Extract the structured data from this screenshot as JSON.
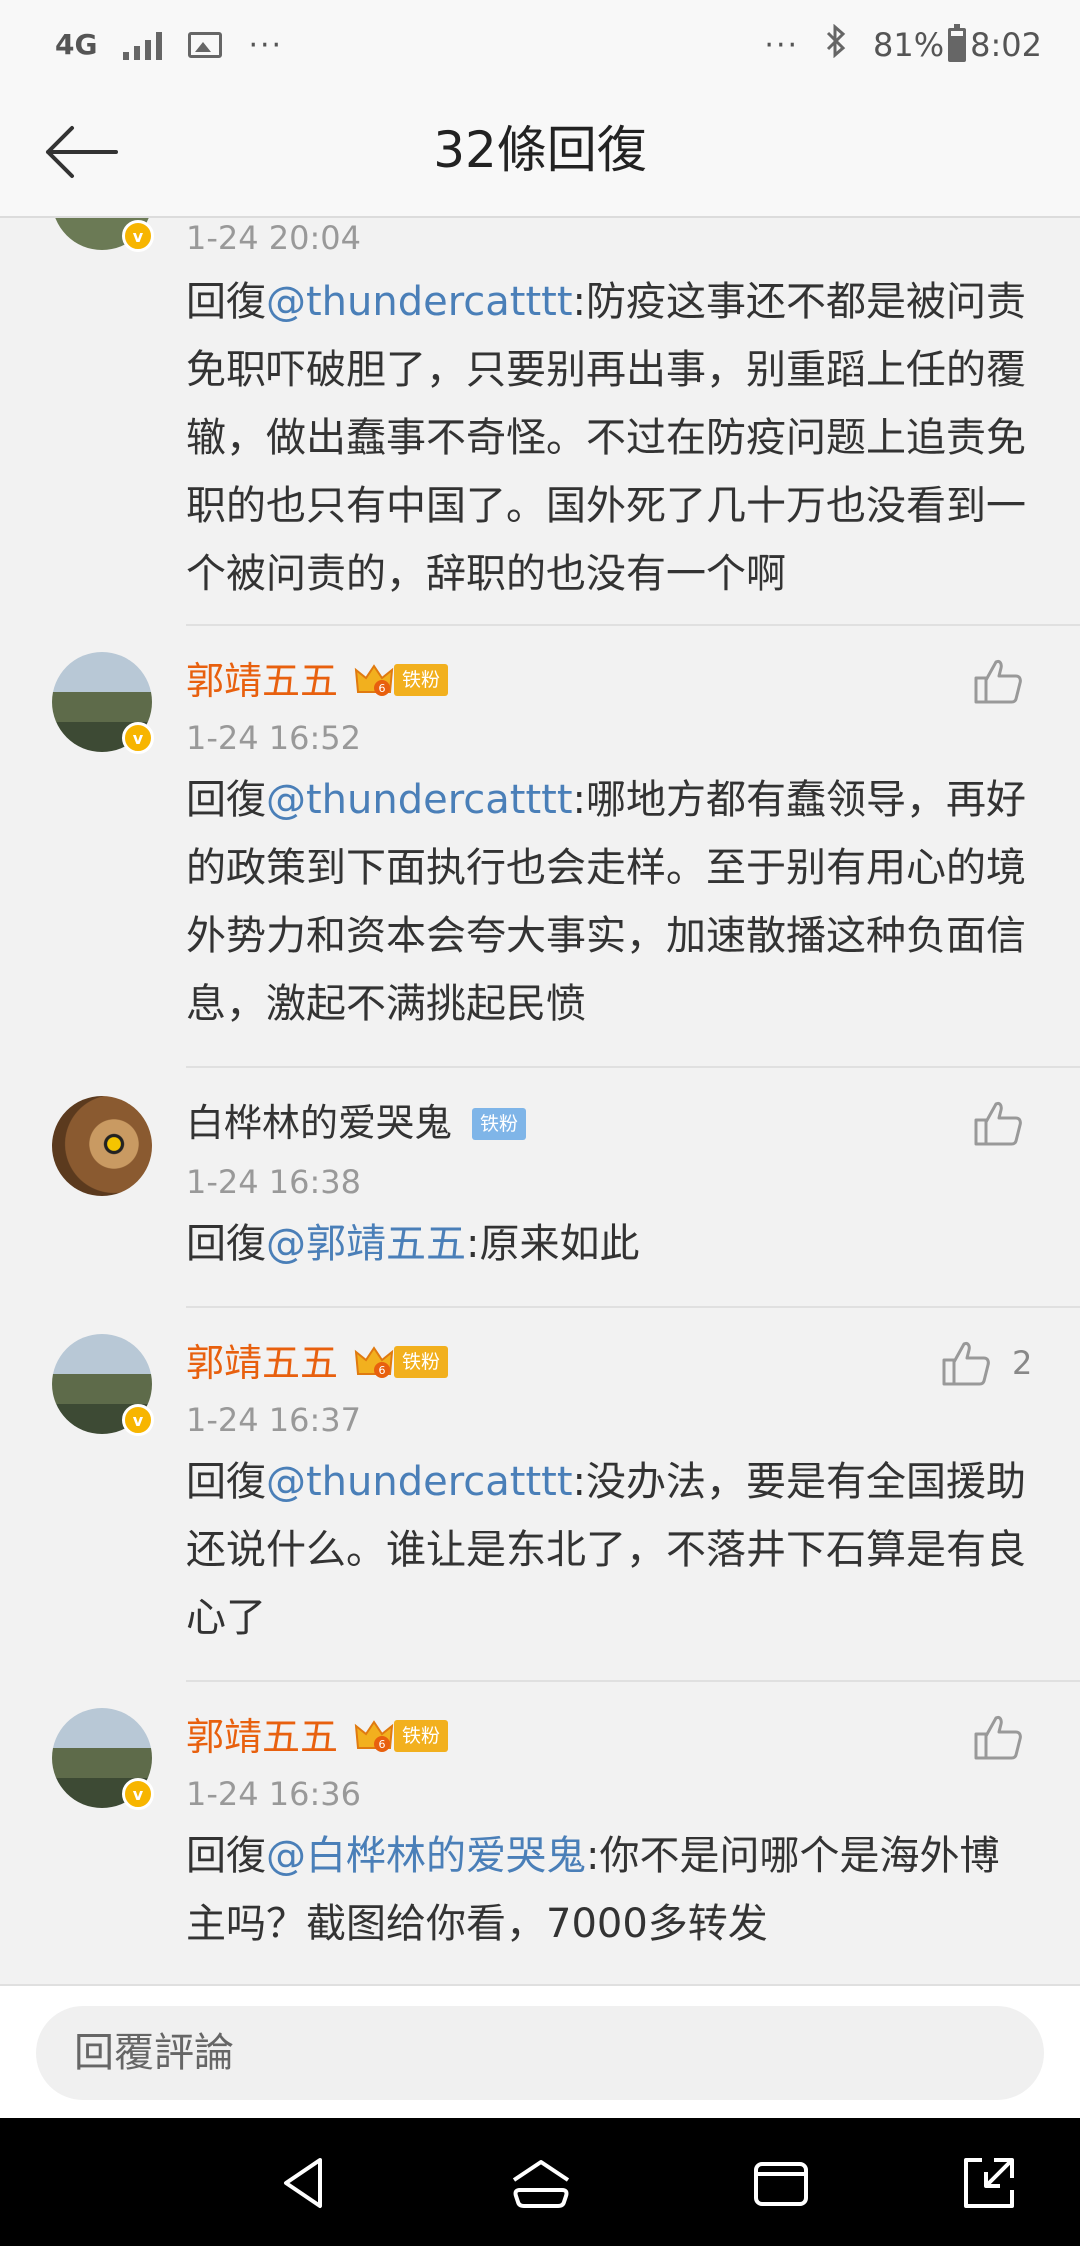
{
  "status_bar": {
    "network": "4G",
    "overflow": "···",
    "overflow_right": "···",
    "battery": "81%",
    "battery_level": 0.81,
    "time": "8:02"
  },
  "header": {
    "title": "32條回復",
    "back_icon": "arrow-left-icon"
  },
  "comments": [
    {
      "time": "1-24 20:04",
      "prefix": "回復",
      "mention": "@thundercatttt",
      "text": ":防疫这事还不都是被问责免职吓破胆了，只要别再出事，别重蹈上任的覆辙，做出蠢事不奇怪。不过在防疫问题上追责免职的也只有中国了。国外死了几十万也没看到一个被问责的，辞职的也没有一个啊"
    },
    {
      "user": "郭靖五五",
      "badge": "铁粉",
      "time": "1-24 16:52",
      "prefix": "回復",
      "mention": "@thundercatttt",
      "text": ":哪地方都有蠢领导，再好的政策到下面执行也会走样。至于别有用心的境外势力和资本会夸大事实，加速散播这种负面信息，激起不满挑起民愤"
    },
    {
      "user": "白桦林的爱哭鬼",
      "badge": "铁粉",
      "time": "1-24 16:38",
      "prefix": "回復",
      "mention": "@郭靖五五",
      "text": ":原来如此"
    },
    {
      "user": "郭靖五五",
      "badge": "铁粉",
      "time": "1-24 16:37",
      "likes": "2",
      "prefix": "回復",
      "mention": "@thundercatttt",
      "text": ":没办法，要是有全国援助还说什么。谁让是东北了，不落井下石算是有良心了"
    },
    {
      "user": "郭靖五五",
      "badge": "铁粉",
      "time": "1-24 16:36",
      "prefix": "回復",
      "mention": "@白桦林的爱哭鬼",
      "text": ":你不是问哪个是海外博主吗？截图给你看，7000多转发"
    }
  ],
  "reply_bar": {
    "placeholder": "回覆評論"
  },
  "nav": {
    "back": "triangle-back-icon",
    "home": "home-icon",
    "recents": "recents-icon",
    "expand": "expand-icon"
  },
  "colors": {
    "vip_name": "#e8600e",
    "mention": "#4a7fb8",
    "badge_gold": "#f2b01e",
    "badge_blue": "#7fb5e8"
  }
}
